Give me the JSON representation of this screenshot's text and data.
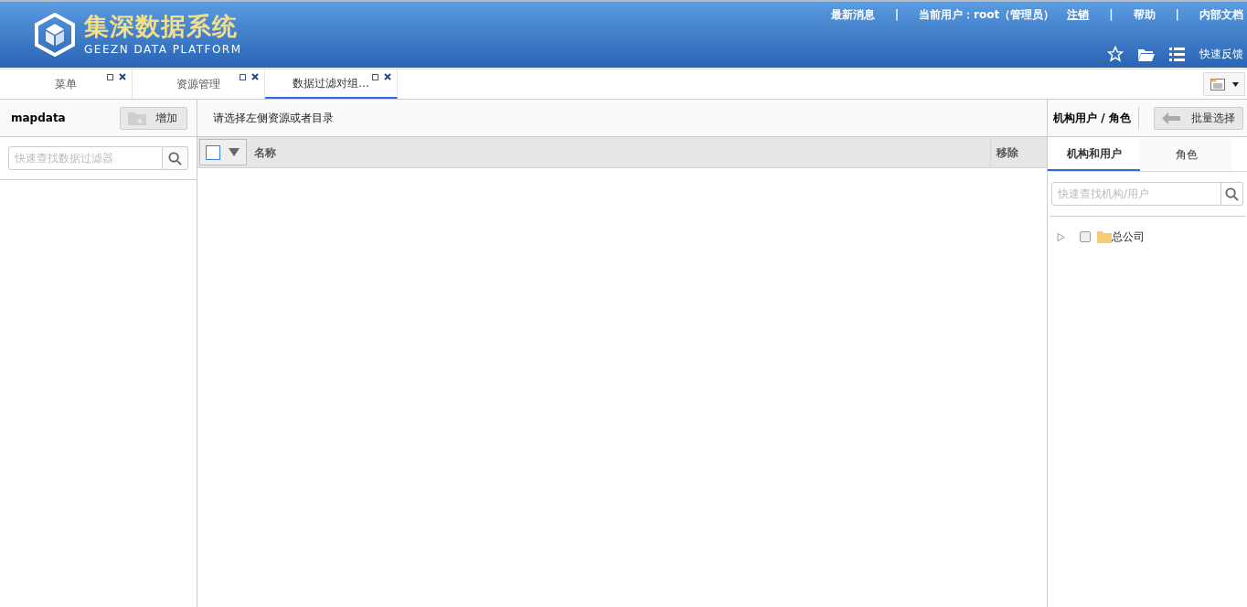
{
  "header": {
    "logo_title": "集深数据系统",
    "logo_subtitle": "GEEZN DATA PLATFORM",
    "top_links": [
      {
        "kind": "link",
        "text": "最新消息",
        "underlined": false
      },
      {
        "kind": "separator",
        "text": "|"
      },
      {
        "kind": "text",
        "text": "当前用户：root（管理员）"
      },
      {
        "kind": "link",
        "text": "注销",
        "underlined": true
      },
      {
        "kind": "separator",
        "text": "|"
      },
      {
        "kind": "link",
        "text": "帮助",
        "underlined": false
      },
      {
        "kind": "separator",
        "text": "|"
      },
      {
        "kind": "link",
        "text": "内部文档",
        "underlined": false
      }
    ],
    "feedback": "快速反馈"
  },
  "tabs": [
    {
      "label": "菜单",
      "selected": false
    },
    {
      "label": "资源管理",
      "selected": false
    },
    {
      "label": "数据过滤对组...",
      "selected": true
    }
  ],
  "left_panel": {
    "title": "mapdata",
    "add_button": "增加",
    "search": {
      "placeholder": "快速查找数据过滤器"
    }
  },
  "middle_panel": {
    "hint": "请选择左侧资源或者目录",
    "select_all": {
      "checked": false
    },
    "columns": [
      "名称",
      "移除"
    ]
  },
  "right_panel": {
    "title": "机构用户 / 角色",
    "batch_button": "批量选择",
    "tabs": [
      {
        "label": "机构和用户",
        "selected": true
      },
      {
        "label": "角色",
        "selected": false
      }
    ],
    "search": {
      "placeholder": "快速查找机构/用户"
    },
    "tree": [
      {
        "label": "总公司",
        "expanded": false,
        "checked": false
      }
    ]
  }
}
